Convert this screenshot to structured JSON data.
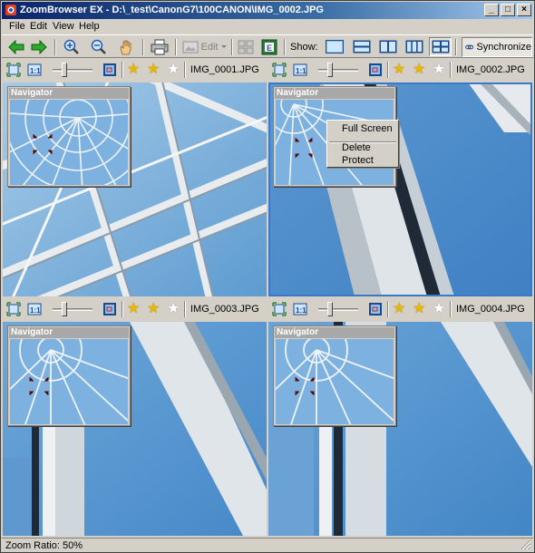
{
  "window": {
    "title": "ZoomBrowser EX - D:\\_test\\CanonG7\\100CANON\\IMG_0002.JPG",
    "minimize_glyph": "_",
    "maximize_glyph": "□",
    "close_glyph": "×"
  },
  "menu": [
    "File",
    "Edit",
    "View",
    "Help"
  ],
  "toolbar": {
    "edit_label": "Edit",
    "show_label": "Show:",
    "synchronize_label": "Synchronize",
    "layouts": [
      "single",
      "two-horizontal",
      "two-vertical",
      "three-vertical",
      "four-grid"
    ],
    "active_layout": "four-grid",
    "icons": [
      "back-arrow-icon",
      "forward-arrow-icon",
      "zoom-in-icon",
      "zoom-out-icon",
      "hand-pan-icon",
      "print-icon",
      "edit-image-icon",
      "compare-icon",
      "export-icon"
    ]
  },
  "panes": [
    {
      "filename": "IMG_0001.JPG",
      "stars": 2,
      "selected": false,
      "navigator_title": "Navigator"
    },
    {
      "filename": "IMG_0002.JPG",
      "stars": 2,
      "selected": true,
      "navigator_title": "Navigator"
    },
    {
      "filename": "IMG_0003.JPG",
      "stars": 2,
      "selected": false,
      "navigator_title": "Navigator"
    },
    {
      "filename": "IMG_0004.JPG",
      "stars": 2,
      "selected": false,
      "navigator_title": "Navigator"
    }
  ],
  "context_menu": {
    "items": [
      "Full Screen",
      "Delete",
      "Protect"
    ]
  },
  "status": {
    "zoom_ratio": "Zoom Ratio: 50%"
  },
  "colors": {
    "sky": "#6fa8dc",
    "selection": "#3a78c8",
    "star_on": "#e8b800"
  }
}
